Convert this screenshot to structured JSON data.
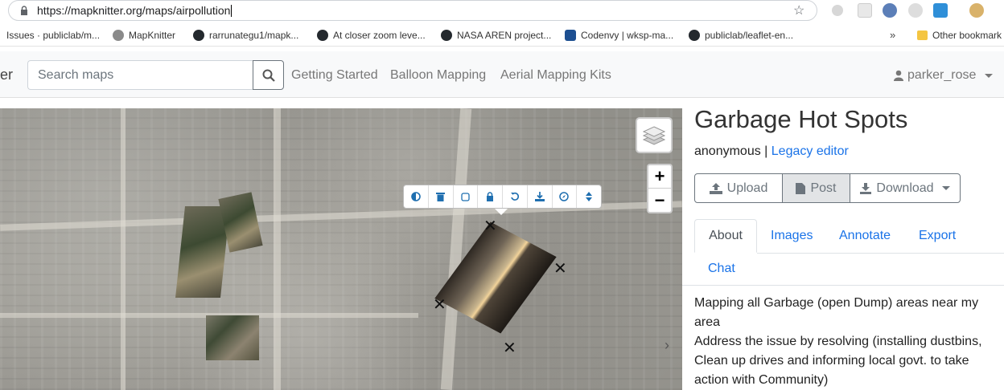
{
  "browser": {
    "url_host": "https://mapknitter.org",
    "url_path": "/maps/airpollution",
    "bookmarks": [
      {
        "label": "Issues · publiclab/m..."
      },
      {
        "label": "MapKnitter"
      },
      {
        "label": "rarrunategu1/mapk..."
      },
      {
        "label": "At closer zoom leve..."
      },
      {
        "label": "NASA AREN project..."
      },
      {
        "label": "Codenvy | wksp-ma..."
      },
      {
        "label": "publiclab/leaflet-en..."
      }
    ],
    "bookmarks_more": "»",
    "other_bookmarks": "Other bookmark"
  },
  "navbar": {
    "brand_tail": "er",
    "search_placeholder": "Search maps",
    "links": [
      "Getting Started",
      "Balloon Mapping",
      "Aerial Mapping Kits"
    ],
    "user": "parker_rose"
  },
  "map": {
    "zoom_in": "+",
    "zoom_out": "−",
    "next_chevron": "›",
    "toolbar_tools": [
      "contrast-icon",
      "trash-icon",
      "outline-icon",
      "lock-icon",
      "rotate-icon",
      "download-icon",
      "compass-icon",
      "sort-icon"
    ]
  },
  "sidebar": {
    "title": "Garbage Hot Spots",
    "author": "anonymous",
    "separator": "|",
    "legacy_link": "Legacy editor",
    "buttons": {
      "upload": "Upload",
      "post": "Post",
      "download": "Download"
    },
    "tabs": [
      "About",
      "Images",
      "Annotate",
      "Export",
      "Chat"
    ],
    "description": "Mapping all Garbage (open Dump) areas near my area\nAddress the issue by resolving (installing dustbins,\nClean up drives and informing local govt. to take\naction with Community)"
  }
}
